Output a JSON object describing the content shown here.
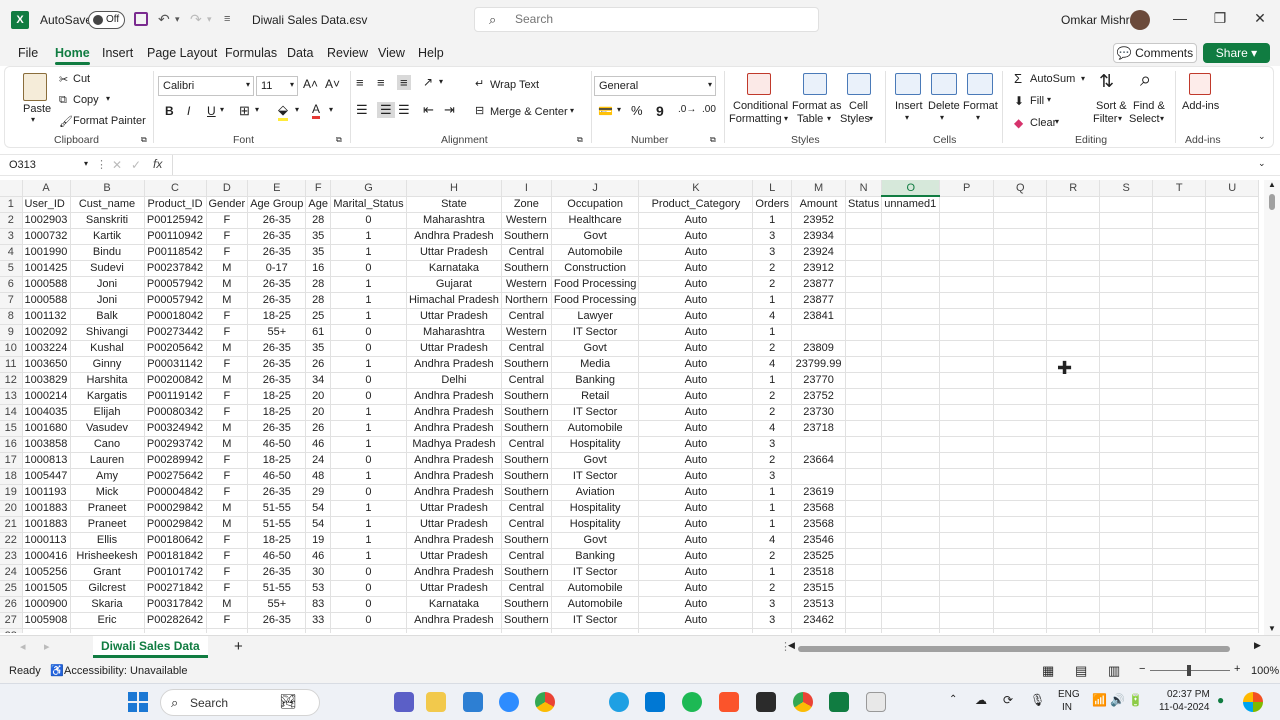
{
  "titlebar": {
    "autosave_label": "AutoSave",
    "autosave_state": "Off",
    "doc_title": "Diwali Sales Data.csv",
    "search_placeholder": "Search",
    "user_name": "Omkar Mishra"
  },
  "menu": {
    "tabs": [
      "File",
      "Home",
      "Insert",
      "Page Layout",
      "Formulas",
      "Data",
      "Review",
      "View",
      "Help"
    ],
    "active": "Home",
    "comments": "Comments",
    "share": "Share"
  },
  "ribbon": {
    "clipboard": {
      "paste": "Paste",
      "cut": "Cut",
      "copy": "Copy",
      "format_painter": "Format Painter",
      "label": "Clipboard"
    },
    "font": {
      "name": "Calibri",
      "size": "11",
      "label": "Font"
    },
    "alignment": {
      "wrap": "Wrap Text",
      "merge": "Merge & Center",
      "label": "Alignment"
    },
    "number": {
      "format": "General",
      "label": "Number"
    },
    "styles": {
      "conditional": "Conditional",
      "conditional2": "Formatting",
      "format_as": "Format as",
      "format_as2": "Table",
      "cell": "Cell",
      "cell2": "Styles",
      "label": "Styles"
    },
    "cells": {
      "insert": "Insert",
      "delete": "Delete",
      "format": "Format",
      "label": "Cells"
    },
    "editing": {
      "autosum": "AutoSum",
      "fill": "Fill",
      "clear": "Clear",
      "sort": "Sort &",
      "sort2": "Filter",
      "find": "Find &",
      "find2": "Select",
      "label": "Editing"
    },
    "addins": {
      "addins": "Add-ins",
      "label": "Add-ins"
    }
  },
  "formula_bar": {
    "name_box": "O313",
    "fx": "fx",
    "value": ""
  },
  "grid": {
    "columns": [
      "A",
      "B",
      "C",
      "D",
      "E",
      "F",
      "G",
      "H",
      "I",
      "J",
      "K",
      "L",
      "M",
      "N",
      "O",
      "P",
      "Q",
      "R",
      "S",
      "T",
      "U"
    ],
    "active_column": "O",
    "header_row": [
      "User_ID",
      "Cust_name",
      "Product_ID",
      "Gender",
      "Age Group",
      "Age",
      "Marital_Status",
      "State",
      "Zone",
      "Occupation",
      "Product_Category",
      "Orders",
      "Amount",
      "Status",
      "unnamed1"
    ],
    "rows": [
      [
        "1002903",
        "Sanskriti",
        "P00125942",
        "F",
        "26-35",
        "28",
        "0",
        "Maharashtra",
        "Western",
        "Healthcare",
        "Auto",
        "1",
        "23952"
      ],
      [
        "1000732",
        "Kartik",
        "P00110942",
        "F",
        "26-35",
        "35",
        "1",
        "Andhra Pradesh",
        "Southern",
        "Govt",
        "Auto",
        "3",
        "23934"
      ],
      [
        "1001990",
        "Bindu",
        "P00118542",
        "F",
        "26-35",
        "35",
        "1",
        "Uttar Pradesh",
        "Central",
        "Automobile",
        "Auto",
        "3",
        "23924"
      ],
      [
        "1001425",
        "Sudevi",
        "P00237842",
        "M",
        "0-17",
        "16",
        "0",
        "Karnataka",
        "Southern",
        "Construction",
        "Auto",
        "2",
        "23912"
      ],
      [
        "1000588",
        "Joni",
        "P00057942",
        "M",
        "26-35",
        "28",
        "1",
        "Gujarat",
        "Western",
        "Food Processing",
        "Auto",
        "2",
        "23877"
      ],
      [
        "1000588",
        "Joni",
        "P00057942",
        "M",
        "26-35",
        "28",
        "1",
        "Himachal Pradesh",
        "Northern",
        "Food Processing",
        "Auto",
        "1",
        "23877"
      ],
      [
        "1001132",
        "Balk",
        "P00018042",
        "F",
        "18-25",
        "25",
        "1",
        "Uttar Pradesh",
        "Central",
        "Lawyer",
        "Auto",
        "4",
        "23841"
      ],
      [
        "1002092",
        "Shivangi",
        "P00273442",
        "F",
        "55+",
        "61",
        "0",
        "Maharashtra",
        "Western",
        "IT Sector",
        "Auto",
        "1",
        ""
      ],
      [
        "1003224",
        "Kushal",
        "P00205642",
        "M",
        "26-35",
        "35",
        "0",
        "Uttar Pradesh",
        "Central",
        "Govt",
        "Auto",
        "2",
        "23809"
      ],
      [
        "1003650",
        "Ginny",
        "P00031142",
        "F",
        "26-35",
        "26",
        "1",
        "Andhra Pradesh",
        "Southern",
        "Media",
        "Auto",
        "4",
        "23799.99"
      ],
      [
        "1003829",
        "Harshita",
        "P00200842",
        "M",
        "26-35",
        "34",
        "0",
        "Delhi",
        "Central",
        "Banking",
        "Auto",
        "1",
        "23770"
      ],
      [
        "1000214",
        "Kargatis",
        "P00119142",
        "F",
        "18-25",
        "20",
        "0",
        "Andhra Pradesh",
        "Southern",
        "Retail",
        "Auto",
        "2",
        "23752"
      ],
      [
        "1004035",
        "Elijah",
        "P00080342",
        "F",
        "18-25",
        "20",
        "1",
        "Andhra Pradesh",
        "Southern",
        "IT Sector",
        "Auto",
        "2",
        "23730"
      ],
      [
        "1001680",
        "Vasudev",
        "P00324942",
        "M",
        "26-35",
        "26",
        "1",
        "Andhra Pradesh",
        "Southern",
        "Automobile",
        "Auto",
        "4",
        "23718"
      ],
      [
        "1003858",
        "Cano",
        "P00293742",
        "M",
        "46-50",
        "46",
        "1",
        "Madhya Pradesh",
        "Central",
        "Hospitality",
        "Auto",
        "3",
        ""
      ],
      [
        "1000813",
        "Lauren",
        "P00289942",
        "F",
        "18-25",
        "24",
        "0",
        "Andhra Pradesh",
        "Southern",
        "Govt",
        "Auto",
        "2",
        "23664"
      ],
      [
        "1005447",
        "Amy",
        "P00275642",
        "F",
        "46-50",
        "48",
        "1",
        "Andhra Pradesh",
        "Southern",
        "IT Sector",
        "Auto",
        "3",
        ""
      ],
      [
        "1001193",
        "Mick",
        "P00004842",
        "F",
        "26-35",
        "29",
        "0",
        "Andhra Pradesh",
        "Southern",
        "Aviation",
        "Auto",
        "1",
        "23619"
      ],
      [
        "1001883",
        "Praneet",
        "P00029842",
        "M",
        "51-55",
        "54",
        "1",
        "Uttar Pradesh",
        "Central",
        "Hospitality",
        "Auto",
        "1",
        "23568"
      ],
      [
        "1001883",
        "Praneet",
        "P00029842",
        "M",
        "51-55",
        "54",
        "1",
        "Uttar Pradesh",
        "Central",
        "Hospitality",
        "Auto",
        "1",
        "23568"
      ],
      [
        "1000113",
        "Ellis",
        "P00180642",
        "F",
        "18-25",
        "19",
        "1",
        "Andhra Pradesh",
        "Southern",
        "Govt",
        "Auto",
        "4",
        "23546"
      ],
      [
        "1000416",
        "Hrisheekesh",
        "P00181842",
        "F",
        "46-50",
        "46",
        "1",
        "Uttar Pradesh",
        "Central",
        "Banking",
        "Auto",
        "2",
        "23525"
      ],
      [
        "1005256",
        "Grant",
        "P00101742",
        "F",
        "26-35",
        "30",
        "0",
        "Andhra Pradesh",
        "Southern",
        "IT Sector",
        "Auto",
        "1",
        "23518"
      ],
      [
        "1001505",
        "Gilcrest",
        "P00271842",
        "F",
        "51-55",
        "53",
        "0",
        "Uttar Pradesh",
        "Central",
        "Automobile",
        "Auto",
        "2",
        "23515"
      ],
      [
        "1000900",
        "Skaria",
        "P00317842",
        "M",
        "55+",
        "83",
        "0",
        "Karnataka",
        "Southern",
        "Automobile",
        "Auto",
        "3",
        "23513"
      ],
      [
        "1005908",
        "Eric",
        "P00282642",
        "F",
        "26-35",
        "33",
        "0",
        "Andhra Pradesh",
        "Southern",
        "IT Sector",
        "Auto",
        "3",
        "23462"
      ]
    ]
  },
  "sheetbar": {
    "sheet": "Diwali Sales Data",
    "add": "+"
  },
  "statusbar": {
    "ready": "Ready",
    "accessibility": "Accessibility: Unavailable",
    "zoom": "100%"
  },
  "taskbar": {
    "search": "Search",
    "lang1": "ENG",
    "lang2": "IN",
    "time": "02:37 PM",
    "date": "11-04-2024"
  }
}
